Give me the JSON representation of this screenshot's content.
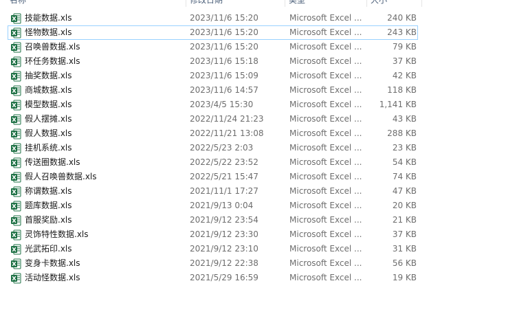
{
  "columns": {
    "name": "名称",
    "date": "修改日期",
    "type": "类型",
    "size": "大小"
  },
  "files": [
    {
      "name": "技能数据.xls",
      "date": "2023/11/6 15:20",
      "type": "Microsoft Excel ...",
      "size": "240 KB"
    },
    {
      "name": "怪物数据.xls",
      "date": "2023/11/6 15:20",
      "type": "Microsoft Excel ...",
      "size": "243 KB"
    },
    {
      "name": "召唤兽数据.xls",
      "date": "2023/11/6 15:20",
      "type": "Microsoft Excel ...",
      "size": "79 KB"
    },
    {
      "name": "环任务数据.xls",
      "date": "2023/11/6 15:18",
      "type": "Microsoft Excel ...",
      "size": "37 KB"
    },
    {
      "name": "抽奖数据.xls",
      "date": "2023/11/6 15:09",
      "type": "Microsoft Excel ...",
      "size": "42 KB"
    },
    {
      "name": "商城数据.xls",
      "date": "2023/11/6 14:57",
      "type": "Microsoft Excel ...",
      "size": "118 KB"
    },
    {
      "name": "模型数据.xls",
      "date": "2023/4/5 15:30",
      "type": "Microsoft Excel ...",
      "size": "1,141 KB"
    },
    {
      "name": "假人摆摊.xls",
      "date": "2022/11/24 21:23",
      "type": "Microsoft Excel ...",
      "size": "43 KB"
    },
    {
      "name": "假人数据.xls",
      "date": "2022/11/21 13:08",
      "type": "Microsoft Excel ...",
      "size": "288 KB"
    },
    {
      "name": "挂机系统.xls",
      "date": "2022/5/23 2:03",
      "type": "Microsoft Excel ...",
      "size": "23 KB"
    },
    {
      "name": "传送圈数据.xls",
      "date": "2022/5/22 23:52",
      "type": "Microsoft Excel ...",
      "size": "54 KB"
    },
    {
      "name": "假人召唤兽数据.xls",
      "date": "2022/5/21 15:47",
      "type": "Microsoft Excel ...",
      "size": "74 KB"
    },
    {
      "name": "称谓数据.xls",
      "date": "2021/11/1 17:27",
      "type": "Microsoft Excel ...",
      "size": "47 KB"
    },
    {
      "name": "题库数据.xls",
      "date": "2021/9/13 0:04",
      "type": "Microsoft Excel ...",
      "size": "20 KB"
    },
    {
      "name": "首服奖励.xls",
      "date": "2021/9/12 23:54",
      "type": "Microsoft Excel ...",
      "size": "21 KB"
    },
    {
      "name": "灵饰特性数据.xls",
      "date": "2021/9/12 23:30",
      "type": "Microsoft Excel ...",
      "size": "37 KB"
    },
    {
      "name": "光武拓印.xls",
      "date": "2021/9/12 23:10",
      "type": "Microsoft Excel ...",
      "size": "31 KB"
    },
    {
      "name": "变身卡数据.xls",
      "date": "2021/9/12 22:38",
      "type": "Microsoft Excel ...",
      "size": "56 KB"
    },
    {
      "name": "活动怪数据.xls",
      "date": "2021/5/29 16:59",
      "type": "Microsoft Excel ...",
      "size": "19 KB"
    }
  ],
  "selected_index": 1,
  "icon": "excel-file-icon",
  "colors": {
    "excel_green": "#1d7044",
    "selection_border": "#99d1ff"
  }
}
